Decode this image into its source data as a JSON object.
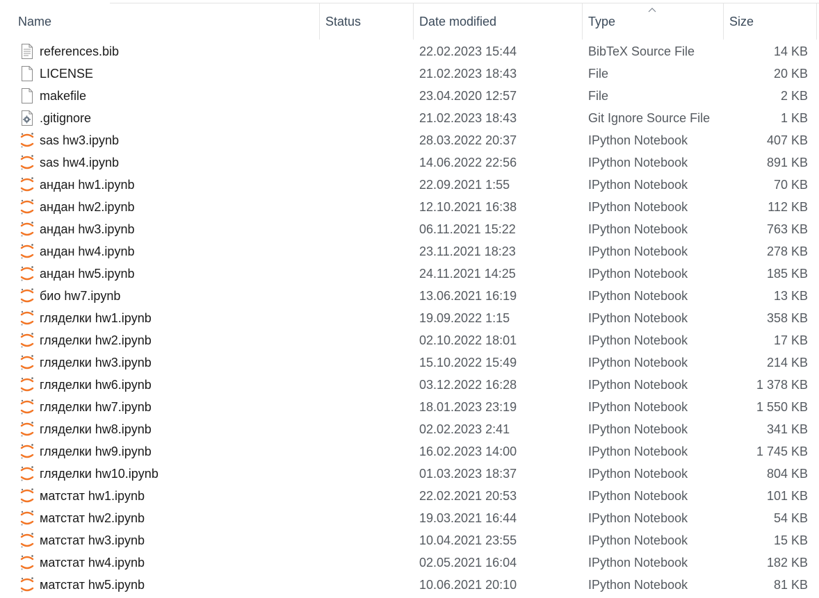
{
  "columns": {
    "name": "Name",
    "status": "Status",
    "date": "Date modified",
    "type": "Type",
    "size": "Size"
  },
  "sort": {
    "column": "type",
    "direction": "ascending"
  },
  "accent": "#f37626",
  "files": [
    {
      "name": "references.bib",
      "date": "22.02.2023 15:44",
      "type": "BibTeX Source File",
      "size": "14 KB",
      "icon": "text-file-icon"
    },
    {
      "name": "LICENSE",
      "date": "21.02.2023 18:43",
      "type": "File",
      "size": "20 KB",
      "icon": "blank-file-icon"
    },
    {
      "name": "makefile",
      "date": "23.04.2020 12:57",
      "type": "File",
      "size": "2 KB",
      "icon": "blank-file-icon"
    },
    {
      "name": ".gitignore",
      "date": "21.02.2023 18:43",
      "type": "Git Ignore Source File",
      "size": "1 KB",
      "icon": "config-file-icon"
    },
    {
      "name": "sas hw3.ipynb",
      "date": "28.03.2022 20:37",
      "type": "IPython Notebook",
      "size": "407 KB",
      "icon": "jupyter-icon"
    },
    {
      "name": "sas hw4.ipynb",
      "date": "14.06.2022 22:56",
      "type": "IPython Notebook",
      "size": "891 KB",
      "icon": "jupyter-icon"
    },
    {
      "name": "андан hw1.ipynb",
      "date": "22.09.2021 1:55",
      "type": "IPython Notebook",
      "size": "70 KB",
      "icon": "jupyter-icon"
    },
    {
      "name": "андан hw2.ipynb",
      "date": "12.10.2021 16:38",
      "type": "IPython Notebook",
      "size": "112 KB",
      "icon": "jupyter-icon"
    },
    {
      "name": "андан hw3.ipynb",
      "date": "06.11.2021 15:22",
      "type": "IPython Notebook",
      "size": "763 KB",
      "icon": "jupyter-icon"
    },
    {
      "name": "андан hw4.ipynb",
      "date": "23.11.2021 18:23",
      "type": "IPython Notebook",
      "size": "278 KB",
      "icon": "jupyter-icon"
    },
    {
      "name": "андан hw5.ipynb",
      "date": "24.11.2021 14:25",
      "type": "IPython Notebook",
      "size": "185 KB",
      "icon": "jupyter-icon"
    },
    {
      "name": "био hw7.ipynb",
      "date": "13.06.2021 16:19",
      "type": "IPython Notebook",
      "size": "13 KB",
      "icon": "jupyter-icon"
    },
    {
      "name": "гляделки hw1.ipynb",
      "date": "19.09.2022 1:15",
      "type": "IPython Notebook",
      "size": "358 KB",
      "icon": "jupyter-icon"
    },
    {
      "name": "гляделки hw2.ipynb",
      "date": "02.10.2022 18:01",
      "type": "IPython Notebook",
      "size": "17 KB",
      "icon": "jupyter-icon"
    },
    {
      "name": "гляделки hw3.ipynb",
      "date": "15.10.2022 15:49",
      "type": "IPython Notebook",
      "size": "214 KB",
      "icon": "jupyter-icon"
    },
    {
      "name": "гляделки hw6.ipynb",
      "date": "03.12.2022 16:28",
      "type": "IPython Notebook",
      "size": "1 378 KB",
      "icon": "jupyter-icon"
    },
    {
      "name": "гляделки hw7.ipynb",
      "date": "18.01.2023 23:19",
      "type": "IPython Notebook",
      "size": "1 550 KB",
      "icon": "jupyter-icon"
    },
    {
      "name": "гляделки hw8.ipynb",
      "date": "02.02.2023 2:41",
      "type": "IPython Notebook",
      "size": "341 KB",
      "icon": "jupyter-icon"
    },
    {
      "name": "гляделки hw9.ipynb",
      "date": "16.02.2023 14:00",
      "type": "IPython Notebook",
      "size": "1 745 KB",
      "icon": "jupyter-icon"
    },
    {
      "name": "гляделки hw10.ipynb",
      "date": "01.03.2023 18:37",
      "type": "IPython Notebook",
      "size": "804 KB",
      "icon": "jupyter-icon"
    },
    {
      "name": "матстат hw1.ipynb",
      "date": "22.02.2021 20:53",
      "type": "IPython Notebook",
      "size": "101 KB",
      "icon": "jupyter-icon"
    },
    {
      "name": "матстат hw2.ipynb",
      "date": "19.03.2021 16:44",
      "type": "IPython Notebook",
      "size": "54 KB",
      "icon": "jupyter-icon"
    },
    {
      "name": "матстат hw3.ipynb",
      "date": "10.04.2021 23:55",
      "type": "IPython Notebook",
      "size": "15 KB",
      "icon": "jupyter-icon"
    },
    {
      "name": "матстат hw4.ipynb",
      "date": "02.05.2021 16:04",
      "type": "IPython Notebook",
      "size": "182 KB",
      "icon": "jupyter-icon"
    },
    {
      "name": "матстат hw5.ipynb",
      "date": "10.06.2021 20:10",
      "type": "IPython Notebook",
      "size": "81 KB",
      "icon": "jupyter-icon"
    }
  ]
}
